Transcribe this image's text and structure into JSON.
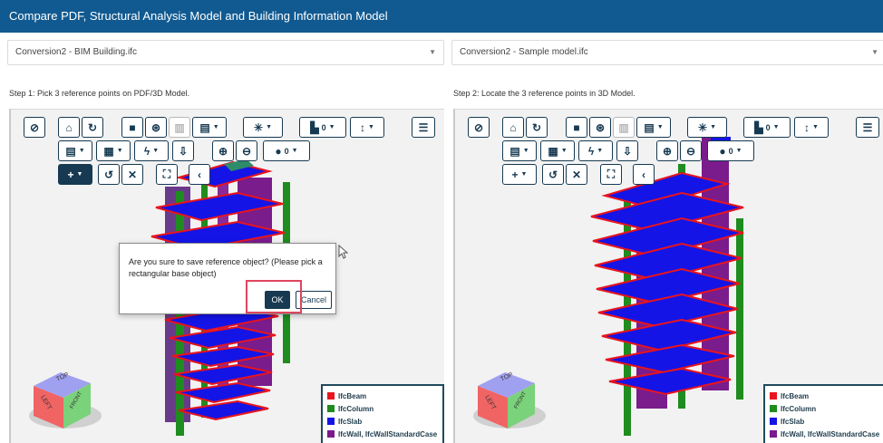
{
  "title": "Compare PDF, Structural Analysis Model and Building Information Model",
  "colors": {
    "title_bar": "#115a91",
    "toolbar_border": "#173a52",
    "beam": "#e8141e",
    "column": "#1e8c1e",
    "slab": "#1414e6",
    "wall": "#7a1c8c",
    "highlight": "#e0455e"
  },
  "left": {
    "file_select": "Conversion2 - BIM Building.ifc",
    "step_label": "Step 1: Pick 3 reference points on PDF/3D Model.",
    "toolbar": {
      "pdf_count": "0",
      "comment_count": "0"
    },
    "legend": [
      "IfcBeam",
      "IfcColumn",
      "IfcSlab",
      "IfcWall, IfcWallStandardCase"
    ],
    "nav_cube": {
      "top": "TOP",
      "left": "LEFT",
      "front": "FRONT"
    }
  },
  "right": {
    "file_select": "Conversion2 - Sample model.ifc",
    "step_label": "Step 2: Locate the 3 reference points in 3D Model.",
    "toolbar": {
      "pdf_count": "0",
      "comment_count": "0"
    },
    "legend": [
      "IfcBeam",
      "IfcColumn",
      "IfcSlab",
      "IfcWall, IfcWallStandardCase"
    ],
    "nav_cube": {
      "top": "TOP",
      "left": "LEFT",
      "front": "FRONT"
    }
  },
  "dialog": {
    "message": "Are you sure to save reference object? (Please pick a rectangular base object)",
    "ok_label": "OK",
    "cancel_label": "Cancel"
  }
}
